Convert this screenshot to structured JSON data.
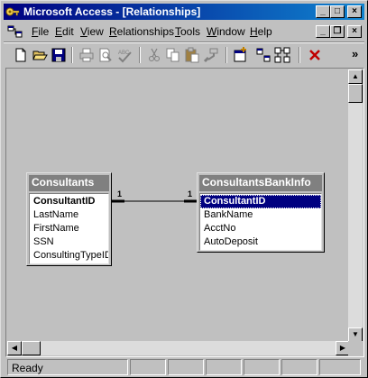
{
  "window": {
    "title": "Microsoft Access - [Relationships]",
    "icon": "access-key-icon"
  },
  "title_buttons": {
    "minimize": "_",
    "maximize": "□",
    "close": "×"
  },
  "menu": {
    "items": [
      {
        "label": "File",
        "ul": "F",
        "rest": "ile"
      },
      {
        "label": "Edit",
        "ul": "E",
        "rest": "dit"
      },
      {
        "label": "View",
        "ul": "V",
        "rest": "iew"
      },
      {
        "label": "Relationships",
        "ul": "R",
        "rest": "elationships"
      },
      {
        "label": "Tools",
        "ul": "T",
        "rest": "ools"
      },
      {
        "label": "Window",
        "ul": "W",
        "rest": "indow"
      },
      {
        "label": "Help",
        "ul": "H",
        "rest": "elp"
      }
    ],
    "doc_buttons": {
      "minimize": "_",
      "restore": "❐",
      "close": "×"
    }
  },
  "toolbar": {
    "icons": [
      "new-icon",
      "open-icon",
      "save-icon",
      "print-icon",
      "print-preview-icon",
      "spelling-icon",
      "cut-icon",
      "copy-icon",
      "paste-icon",
      "format-painter-icon",
      "show-table-icon",
      "show-direct-icon",
      "show-all-icon",
      "delete-icon"
    ],
    "overflow": "»"
  },
  "tables": [
    {
      "name": "Consultants",
      "fields": [
        {
          "name": "ConsultantID",
          "pk": true
        },
        {
          "name": "LastName"
        },
        {
          "name": "FirstName"
        },
        {
          "name": "SSN"
        },
        {
          "name": "ConsultingTypeID"
        }
      ]
    },
    {
      "name": "ConsultantsBankInfo",
      "fields": [
        {
          "name": "ConsultantID",
          "pk": true,
          "selected": true
        },
        {
          "name": "BankName"
        },
        {
          "name": "AcctNo"
        },
        {
          "name": "AutoDeposit"
        }
      ]
    }
  ],
  "relationship": {
    "left_label": "1",
    "right_label": "1"
  },
  "scroll": {
    "up": "▲",
    "down": "▼",
    "left": "◀",
    "right": "▶"
  },
  "status": {
    "text": "Ready"
  },
  "colors": {
    "title_start": "#000080",
    "title_end": "#1084d0",
    "face": "#c0c0c0",
    "selection": "#000080"
  }
}
